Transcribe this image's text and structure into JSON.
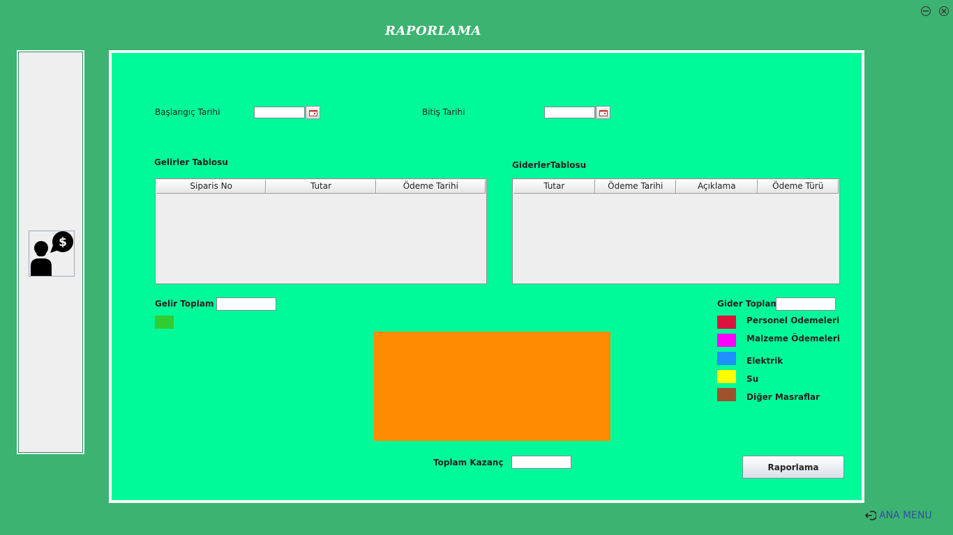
{
  "window": {
    "title": "RAPORLAMA",
    "minimize_icon": "minus-circle-icon",
    "close_icon": "x-circle-icon"
  },
  "sidebar": {
    "avatar_icon": "user-dollar-icon"
  },
  "filters": {
    "start_label": "Başlangıç Tarihi",
    "start_value": "",
    "end_label": "Bitiş Tarihi",
    "end_value": "",
    "calendar_icon": "calendar-icon"
  },
  "income_table": {
    "title": "Gelirler Tablosu",
    "columns": [
      "Siparis No",
      "Tutar",
      "Ödeme Tarihi"
    ],
    "rows": []
  },
  "expense_table": {
    "title": "GiderlerTablosu",
    "columns": [
      "Tutar",
      "Ödeme Tarihi",
      "Açıklama",
      "Ödeme Türü"
    ],
    "rows": []
  },
  "income_total": {
    "label": "Gelir Toplam",
    "value": "",
    "swatch_color": "#32cd32"
  },
  "expense_total": {
    "label": "Gider Toplam",
    "value": ""
  },
  "legend": [
    {
      "label": "Personel Odemeleri",
      "color": "#dc143c"
    },
    {
      "label": "Malzeme Ödemeleri",
      "color": "#ff00ff"
    },
    {
      "label": "Elektrik",
      "color": "#1e90ff"
    },
    {
      "label": "Su",
      "color": "#ffff00"
    },
    {
      "label": "Diğer Masraflar",
      "color": "#a0522d"
    }
  ],
  "chart_area": {
    "color": "#ff8c00"
  },
  "total_profit": {
    "label": "Toplam Kazanç",
    "value": ""
  },
  "report_button": {
    "label": "Raporlama"
  },
  "ana_menu": {
    "label": "ANA MENU",
    "icon": "sign-in-icon"
  },
  "colors": {
    "window_bg": "#3cb371",
    "panel_bg": "#00fa9a",
    "accent": "#ff8c00"
  }
}
